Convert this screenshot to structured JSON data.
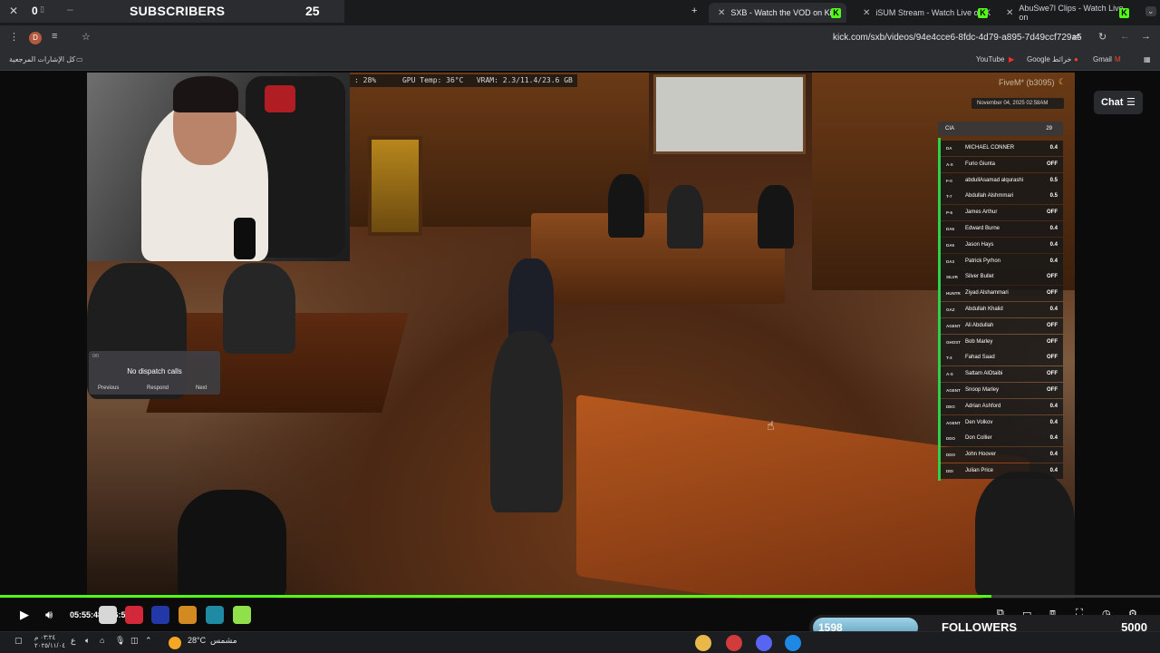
{
  "browser": {
    "tabs": [
      {
        "title": "SXB - Watch the VOD on Kick",
        "active": true
      },
      {
        "title": "iSUM Stream - Watch Live on K",
        "active": false
      },
      {
        "title": "AbuSwe7l Clips - Watch Live on",
        "active": false
      }
    ],
    "new_tab_label": "+",
    "url": "kick.com/sxb/videos/94e4cce6-8fdc-4d79-a895-7d49ccf729a5",
    "profile_initial": "D",
    "bookmarks": {
      "all_bookmarks": "كل الإشارات المرجعية",
      "items": [
        "YouTube",
        "Google خرائط",
        "Gmail"
      ]
    }
  },
  "sub_overlay": {
    "left_count": "0",
    "label": "SUBSCRIBERS",
    "count": "25"
  },
  "stream": {
    "perf_stats": ": 28%      GPU Temp: 36°C   VRAM: 2.3/11.4/23.6 GB",
    "fivem_tag": "FiveM* (b3095)",
    "date": "November 04, 2025 02:58AM",
    "dispatch": {
      "title": "No dispatch calls",
      "tag": "0/0",
      "buttons": [
        "Previous",
        "Respond",
        "Next"
      ]
    },
    "cia_panel": {
      "title": "CIA",
      "count": "29",
      "members": [
        {
          "rank": "DA",
          "name": "MICHAEL CONNER",
          "status": "0.4"
        },
        {
          "rank": "A-X",
          "name": "Furio Giunta",
          "status": "OFF"
        },
        {
          "rank": "F-0",
          "name": "abdullAsamad alqurashi",
          "status": "0.5"
        },
        {
          "rank": "T-7",
          "name": "Abdullah Alshmmari",
          "status": "0.5"
        },
        {
          "rank": "P-5",
          "name": "James Arthur",
          "status": "OFF"
        },
        {
          "rank": "DA6",
          "name": "Edward Burne",
          "status": "0.4"
        },
        {
          "rank": "DA5",
          "name": "Jason Hays",
          "status": "0.4"
        },
        {
          "rank": "DA3",
          "name": "Patrick Pyrhon",
          "status": "0.4"
        },
        {
          "rank": "SILVR",
          "name": "Silver Bullet",
          "status": "OFF"
        },
        {
          "rank": "HUNTR",
          "name": "Ziyad Alshammari",
          "status": "OFF"
        },
        {
          "rank": "GAZ",
          "name": "Abdullah Khalid",
          "status": "0.4"
        },
        {
          "rank": "AGENT",
          "name": "Ali Abdullah",
          "status": "OFF"
        },
        {
          "rank": "GHOST",
          "name": "Bob Marley",
          "status": "OFF"
        },
        {
          "rank": "T-3",
          "name": "Fahad Saad",
          "status": "OFF"
        },
        {
          "rank": "A-S",
          "name": "Sattam AlOtaibi",
          "status": "OFF"
        },
        {
          "rank": "AGENT",
          "name": "Snoop Marley",
          "status": "OFF"
        },
        {
          "rank": "DEO",
          "name": "Adrian Ashford",
          "status": "0.4"
        },
        {
          "rank": "AGENT",
          "name": "Den Volkov",
          "status": "0.4"
        },
        {
          "rank": "DDO",
          "name": "Don Collier",
          "status": "0.4"
        },
        {
          "rank": "DDO",
          "name": "John Hoover",
          "status": "0.4"
        },
        {
          "rank": "DDI",
          "name": "Julian Price",
          "status": "0.4"
        }
      ]
    }
  },
  "chat_button": "Chat",
  "player": {
    "time": "05:55:48 / 06:55:18",
    "progress": 0.855
  },
  "followers_overlay": {
    "count": "1598",
    "label": "FOLLOWERS",
    "goal": "5000"
  },
  "taskbar": {
    "weather_temp": "28°C",
    "weather_label": "مشمس",
    "clock_time": "٠٣:٢٤ م",
    "clock_date": "٢٠٢٥/١١/٠٤",
    "lang": "ع"
  }
}
